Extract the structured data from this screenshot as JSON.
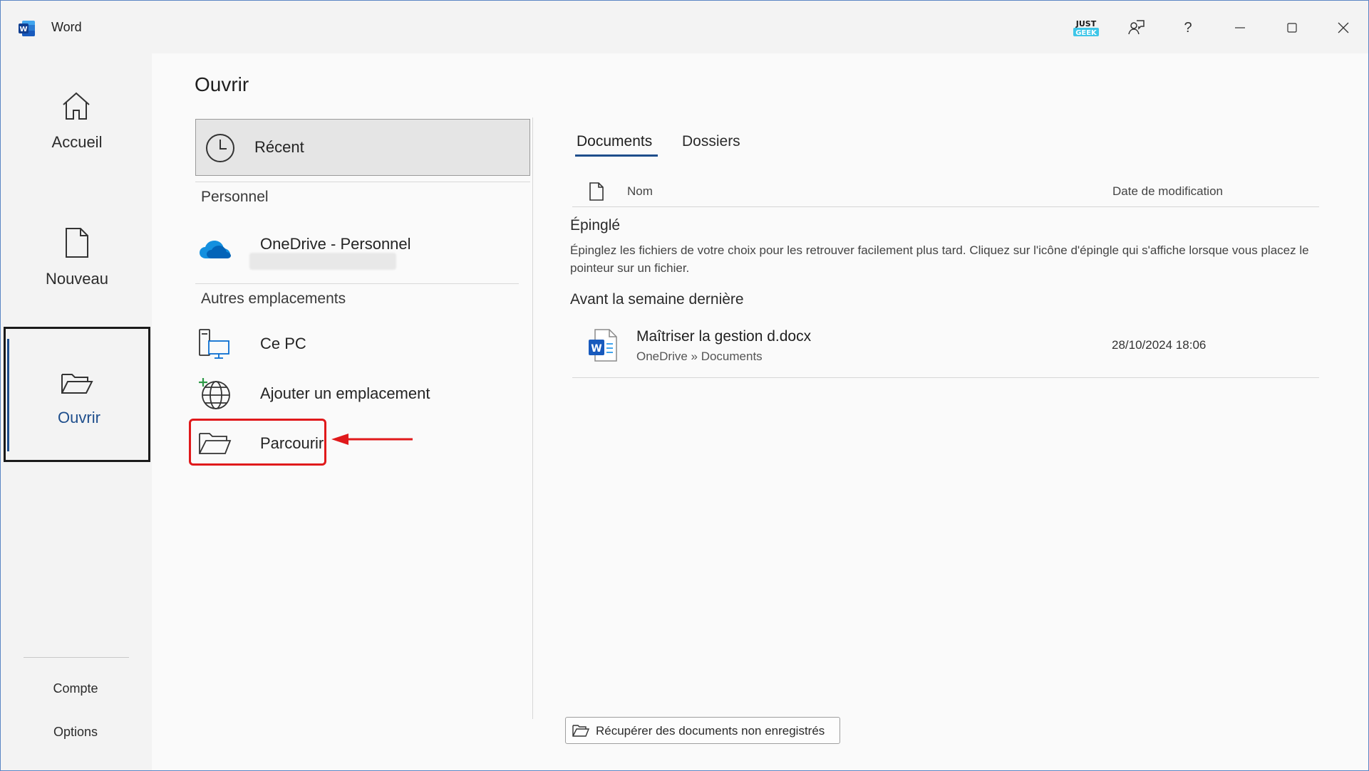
{
  "window": {
    "app_title": "Word"
  },
  "titlebar": {
    "logo_text_top": "JUST",
    "logo_text_bottom": "GEEK",
    "help_label": "?"
  },
  "nav": {
    "items": [
      {
        "label": "Accueil",
        "icon": "home-icon"
      },
      {
        "label": "Nouveau",
        "icon": "new-document-icon"
      },
      {
        "label": "Ouvrir",
        "icon": "open-folder-icon",
        "active": true
      }
    ],
    "footer": [
      {
        "label": "Compte"
      },
      {
        "label": "Options"
      }
    ]
  },
  "page": {
    "title": "Ouvrir"
  },
  "locations": {
    "recent_label": "Récent",
    "personal_header": "Personnel",
    "onedrive_label": "OneDrive - Personnel",
    "other_header": "Autres emplacements",
    "this_pc_label": "Ce PC",
    "add_place_label": "Ajouter un emplacement",
    "browse_label": "Parcourir"
  },
  "files": {
    "tabs": [
      {
        "label": "Documents",
        "active": true
      },
      {
        "label": "Dossiers"
      }
    ],
    "col_name": "Nom",
    "col_date": "Date de modification",
    "pinned_title": "Épinglé",
    "pinned_desc": "Épinglez les fichiers de votre choix pour les retrouver facilement plus tard. Cliquez sur l'icône d'épingle qui s'affiche lorsque vous placez le pointeur sur un fichier.",
    "group_older": "Avant la semaine dernière",
    "rows": [
      {
        "name": "Maîtriser la gestion d.docx",
        "path": "OneDrive » Documents",
        "date": "28/10/2024 18:06"
      }
    ]
  },
  "recover_button": "Récupérer des documents non enregistrés",
  "colors": {
    "accent": "#1e4e8c",
    "highlight": "#e0191b",
    "word_blue": "#185abd"
  }
}
